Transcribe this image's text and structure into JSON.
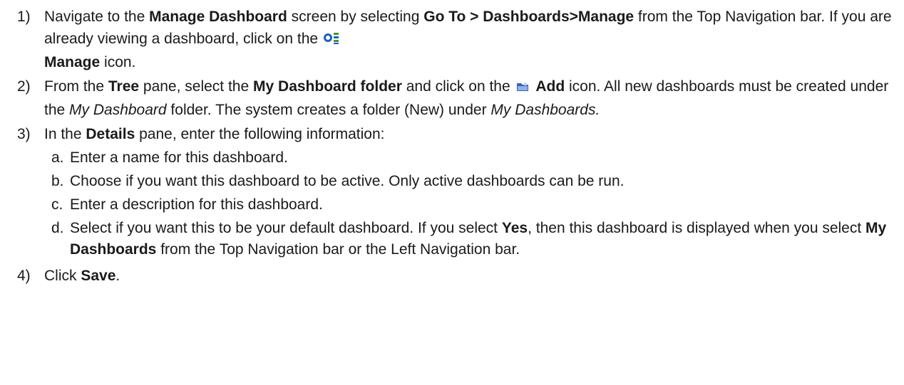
{
  "steps": [
    {
      "number": "1)",
      "parts": {
        "t1": "Navigate to the ",
        "b1": "Manage Dashboard",
        "t2": " screen by selecting ",
        "b2": "Go To > Dashboards>Manage",
        "t3": " from the Top Navigation bar. If you are already viewing a dashboard, click on the ",
        "icon": "manage-icon",
        "b3": "Manage",
        "t4": " icon."
      }
    },
    {
      "number": "2)",
      "parts": {
        "t1": "From the ",
        "b1": "Tree",
        "t2": " pane, select the ",
        "b2": "My Dashboard folder",
        "t3": " and click on the ",
        "icon": "add-icon",
        "b3": "Add",
        "t4": " icon. All new dashboards must be created under the ",
        "i1": "My Dashboard",
        "t5": " folder. The system creates a folder (New) under ",
        "i2": "My Dashboards."
      }
    },
    {
      "number": "3)",
      "parts": {
        "t1": "In the ",
        "b1": "Details",
        "t2": " pane, enter the following information:"
      },
      "substeps": [
        {
          "letter": "a.",
          "text": "Enter a name for this dashboard."
        },
        {
          "letter": "b.",
          "text": "Choose if you want this dashboard to be active. Only active dashboards can be run."
        },
        {
          "letter": "c.",
          "text": "Enter a description for this dashboard."
        },
        {
          "letter": "d.",
          "t1": "Select if you want this to be your default dashboard. If you select ",
          "b1": "Yes",
          "t2": ", then this dashboard is displayed when you select ",
          "b2": "My Dashboards",
          "t3": " from the Top Navigation bar or the Left Navigation bar."
        }
      ]
    },
    {
      "number": "4)",
      "parts": {
        "t1": "Click ",
        "b1": "Save",
        "t2": "."
      }
    }
  ],
  "colors": {
    "text": "#1a1a1a",
    "manage_icon_blue": "#1f5fbf",
    "manage_icon_green": "#3c9a2e",
    "add_icon_blue": "#3b63b8"
  }
}
